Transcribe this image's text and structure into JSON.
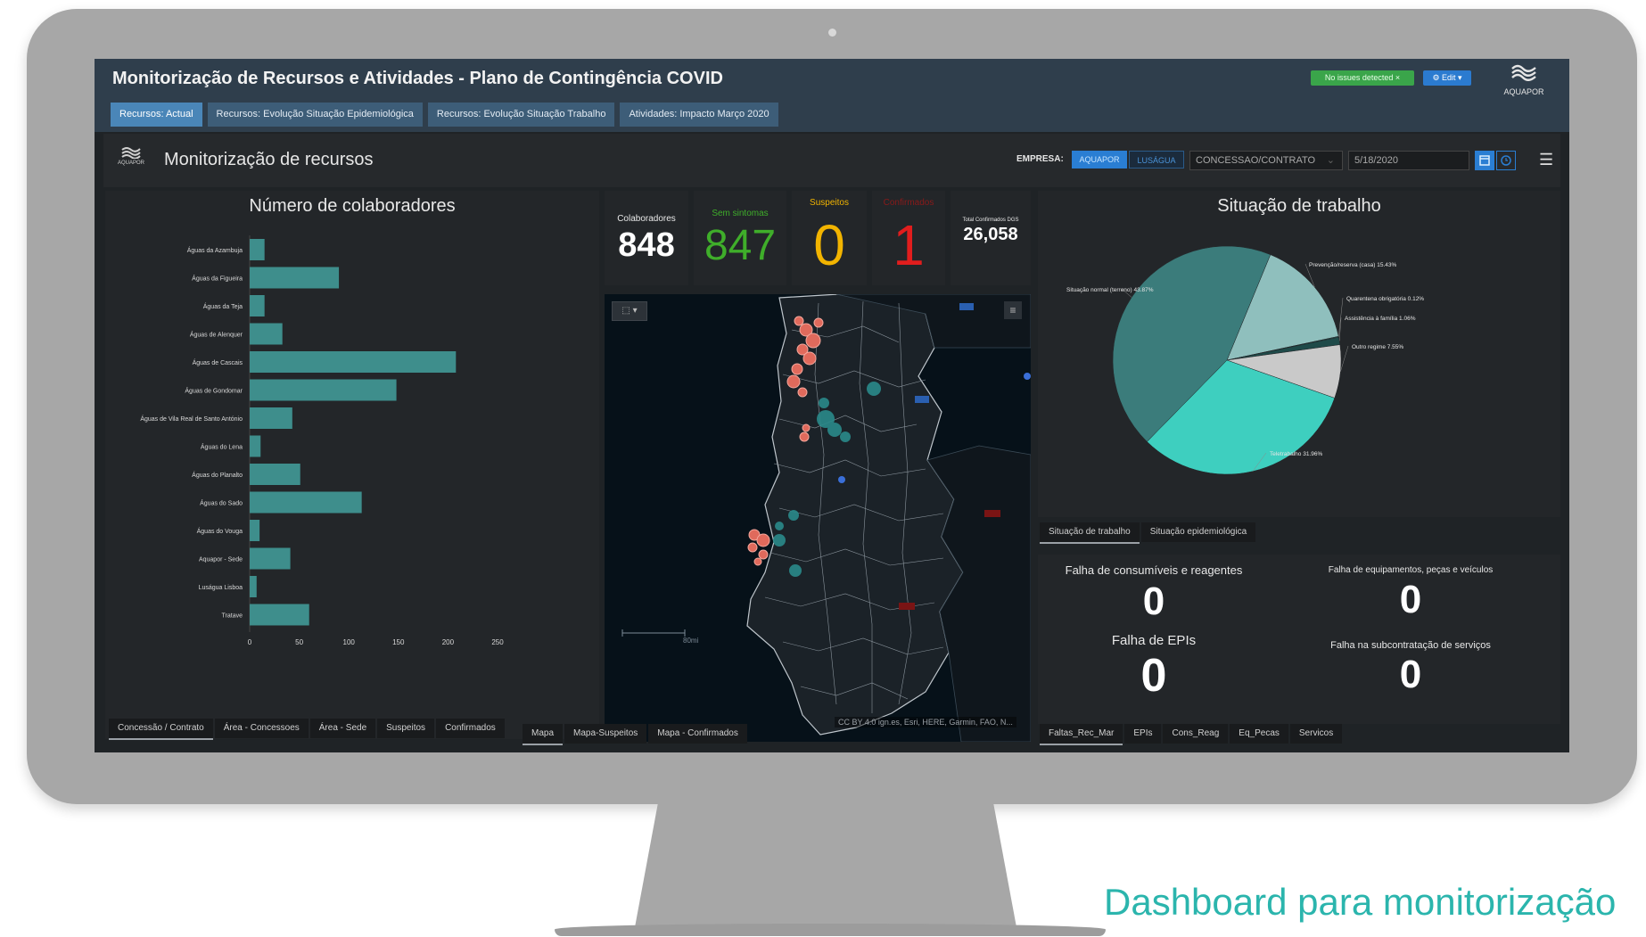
{
  "app": {
    "title": "Monitorização de Recursos e Atividades - Plano de Contingência COVID",
    "status_badge": "No issues detected ×",
    "edit_label": "⚙ Edit ▾",
    "brand": "AQUAPOR",
    "tabs": [
      {
        "label": "Recursos: Actual",
        "active": true
      },
      {
        "label": "Recursos: Evolução Situação Epidemiológica",
        "active": false
      },
      {
        "label": "Recursos: Evolução Situação Trabalho",
        "active": false
      },
      {
        "label": "Atividades: Impacto Março 2020",
        "active": false
      }
    ]
  },
  "subheader": {
    "logo_text": "AQUAPOR",
    "title": "Monitorização de recursos",
    "empresa_label": "EMPRESA:",
    "segments": [
      "AQUAPOR",
      "LUSÁGUA"
    ],
    "concessao_select": "CONCESSAO/CONTRATO",
    "date_value": "5/18/2020"
  },
  "kpis": {
    "colaboradores": {
      "label": "Colaboradores",
      "value": "848",
      "color": "#ffffff"
    },
    "sem_sintomas": {
      "label": "Sem sintomas",
      "value": "847",
      "color": "#3fae2a"
    },
    "suspeitos": {
      "label": "Suspeitos",
      "value": "0",
      "color": "#f2b400"
    },
    "confirmados": {
      "label": "Confirmados",
      "value": "1",
      "color": "#e11d1d"
    },
    "total": {
      "label": "Total Confirmados DGS",
      "value": "26,058",
      "color": "#ffffff"
    }
  },
  "colaboradores_tabs": [
    "Concessão / Contrato",
    "Área - Concessoes",
    "Área - Sede",
    "Suspeitos",
    "Confirmados"
  ],
  "map": {
    "attribution": "CC BY 4.0 ign.es, Esri, HERE, Garmin, FAO, N...",
    "scale_label": "80mi",
    "tabs": [
      "Mapa",
      "Mapa-Suspeitos",
      "Mapa - Confirmados"
    ]
  },
  "situacao_tabs": [
    "Situação de trabalho",
    "Situação epidemiológica"
  ],
  "faltas": {
    "items": [
      {
        "label": "Falha de consumíveis e reagentes",
        "value": "0"
      },
      {
        "label": "Falha de equipamentos, peças e veículos",
        "value": "0"
      },
      {
        "label": "Falha de EPIs",
        "value": "0"
      },
      {
        "label": "Falha na subcontratação de serviços",
        "value": "0"
      }
    ],
    "tabs": [
      "Faltas_Rec_Mar",
      "EPIs",
      "Cons_Reag",
      "Eq_Pecas",
      "Servicos"
    ]
  },
  "caption": "Dashboard para monitorização",
  "chart_data": [
    {
      "type": "bar",
      "orientation": "horizontal",
      "title": "Número de colaboradores",
      "categories": [
        "Águas da Azambuja",
        "Águas da Figueira",
        "Águas da Teja",
        "Águas de Alenquer",
        "Águas de Cascais",
        "Águas de Gondomar",
        "Águas de Vila Real de Santo António",
        "Águas do Lena",
        "Águas do Planalto",
        "Águas do Sado",
        "Águas do Vouga",
        "Aquapor - Sede",
        "Luságua Lisboa",
        "Tratave"
      ],
      "values": [
        15,
        90,
        15,
        33,
        208,
        148,
        43,
        11,
        51,
        113,
        10,
        41,
        7,
        60
      ],
      "xlim": [
        0,
        250
      ],
      "xticks": [
        0,
        50,
        100,
        150,
        200,
        250
      ],
      "bar_color": "#3e8e8c"
    },
    {
      "type": "pie",
      "title": "Situação de trabalho",
      "slices": [
        {
          "label": "Prevenção/reserva (casa)",
          "value": 15.43,
          "text": "Prevenção/reserva (casa) 15.43%",
          "color": "#8fbfbd"
        },
        {
          "label": "Quarentena obrigatória",
          "value": 0.12,
          "text": "Quarentena obrigatória 0.12%",
          "color": "#2d5f5e"
        },
        {
          "label": "Assistência à família",
          "value": 1.06,
          "text": "Assistência à família 1.06%",
          "color": "#1f4a49"
        },
        {
          "label": "Outro regime",
          "value": 7.55,
          "text": "Outro regime 7.55%",
          "color": "#c9c9c9"
        },
        {
          "label": "Teletrabalho",
          "value": 31.96,
          "text": "Teletrabalho 31.96%",
          "color": "#3ecfbf"
        },
        {
          "label": "Situação normal (terreno)",
          "value": 43.87,
          "text": "Situação normal (terreno) 43.87%",
          "color": "#3b7c7b"
        }
      ]
    }
  ]
}
